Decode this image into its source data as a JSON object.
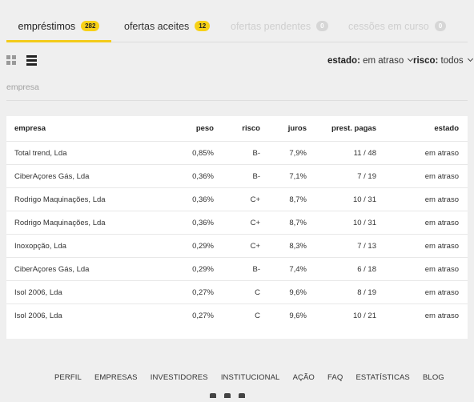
{
  "tabs": [
    {
      "label": "empréstimos",
      "count": "282"
    },
    {
      "label": "ofertas aceites",
      "count": "12"
    },
    {
      "label": "ofertas pendentes",
      "count": "0"
    },
    {
      "label": "cessões em curso",
      "count": "0"
    }
  ],
  "filters": {
    "estado_label": "estado:",
    "estado_value": "em atraso",
    "risco_label": "risco:",
    "risco_value": "todos"
  },
  "search": {
    "placeholder": "empresa"
  },
  "table": {
    "headers": {
      "empresa": "empresa",
      "peso": "peso",
      "risco": "risco",
      "juros": "juros",
      "prest": "prest. pagas",
      "estado": "estado"
    },
    "rows": [
      {
        "empresa": "Total trend, Lda",
        "peso": "0,85%",
        "risco": "B-",
        "juros": "7,9%",
        "prest": "11 / 48",
        "estado": "em atraso"
      },
      {
        "empresa": "CiberAçores Gás, Lda",
        "peso": "0,36%",
        "risco": "B-",
        "juros": "7,1%",
        "prest": "7 / 19",
        "estado": "em atraso"
      },
      {
        "empresa": "Rodrigo Maquinações, Lda",
        "peso": "0,36%",
        "risco": "C+",
        "juros": "8,7%",
        "prest": "10 / 31",
        "estado": "em atraso"
      },
      {
        "empresa": "Rodrigo Maquinações, Lda",
        "peso": "0,36%",
        "risco": "C+",
        "juros": "8,7%",
        "prest": "10 / 31",
        "estado": "em atraso"
      },
      {
        "empresa": "Inoxopção, Lda",
        "peso": "0,29%",
        "risco": "C+",
        "juros": "8,3%",
        "prest": "7 / 13",
        "estado": "em atraso"
      },
      {
        "empresa": "CiberAçores Gás, Lda",
        "peso": "0,29%",
        "risco": "B-",
        "juros": "7,4%",
        "prest": "6 / 18",
        "estado": "em atraso"
      },
      {
        "empresa": "Isol 2006, Lda",
        "peso": "0,27%",
        "risco": "C",
        "juros": "9,6%",
        "prest": "8 / 19",
        "estado": "em atraso"
      },
      {
        "empresa": "Isol 2006, Lda",
        "peso": "0,27%",
        "risco": "C",
        "juros": "9,6%",
        "prest": "10 / 21",
        "estado": "em atraso"
      }
    ]
  },
  "footer": {
    "links": [
      "PERFIL",
      "EMPRESAS",
      "INVESTIDORES",
      "INSTITUCIONAL",
      "AÇÃO",
      "FAQ",
      "ESTATÍSTICAS",
      "BLOG"
    ]
  },
  "colors": {
    "accent": "#f3cb1a",
    "badge_active": "#f7d117",
    "badge_disabled": "#d6d6d6"
  }
}
